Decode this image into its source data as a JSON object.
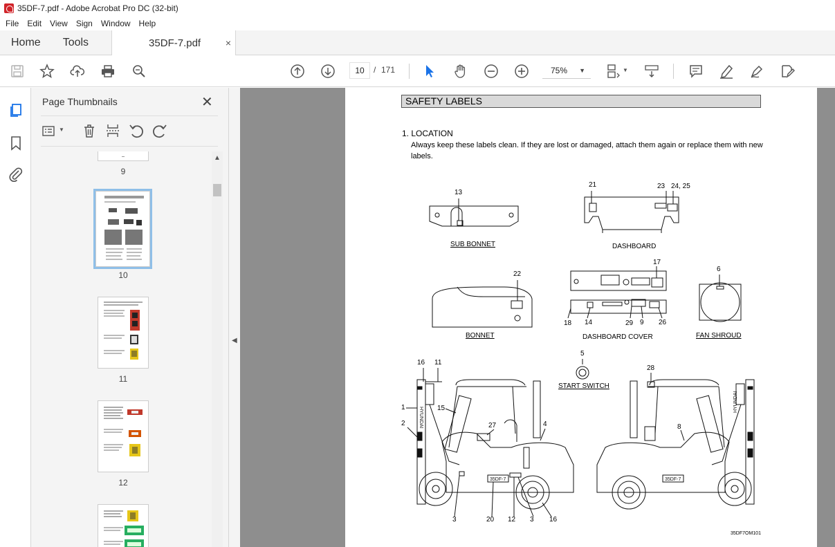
{
  "window": {
    "title": "35DF-7.pdf - Adobe Acrobat Pro DC (32-bit)"
  },
  "menu": [
    "File",
    "Edit",
    "View",
    "Sign",
    "Window",
    "Help"
  ],
  "tabs": {
    "home": "Home",
    "tools": "Tools",
    "document": "35DF-7.pdf",
    "close": "×"
  },
  "toolbar": {
    "page_current": "10",
    "page_sep": "/",
    "page_total": "171",
    "zoom": "75%"
  },
  "thumbnails": {
    "title": "Page Thumbnails",
    "close": "✕",
    "pages": [
      "9",
      "10",
      "11",
      "12"
    ],
    "selected": "10"
  },
  "page": {
    "heading": "SAFETY LABELS",
    "section": "1. LOCATION",
    "body": "Always keep these labels clean.  If they are lost or damaged, attach them again or replace them with new labels.",
    "labels": {
      "sub_bonnet": "SUB BONNET",
      "dashboard": "DASHBOARD",
      "bonnet": "BONNET",
      "dashboard_cover": "DASHBOARD COVER",
      "fan_shroud": "FAN SHROUD",
      "start_switch": "START SWITCH"
    },
    "numbers": {
      "n13": "13",
      "n21": "21",
      "n23": "23",
      "n2425": "24, 25",
      "n22": "22",
      "n17": "17",
      "n6": "6",
      "n18": "18",
      "n14": "14",
      "n29": "29",
      "n9": "9",
      "n26": "26",
      "n5": "5",
      "n16a": "16",
      "n11": "11",
      "n28": "28",
      "n1": "1",
      "n2": "2",
      "n15": "15",
      "n27": "27",
      "n4": "4",
      "n8": "8",
      "n3a": "3",
      "n20": "20",
      "n12": "12",
      "n3b": "3",
      "n16b": "16"
    },
    "brand_mast": "HYUNDAI",
    "model_plate": "35DF-7",
    "drawing_code": "35DF7OM101"
  },
  "colors": {
    "accent": "#1a73e8",
    "pdf_red": "#d1242a",
    "panel_bg": "#f4f4f4",
    "doc_bg": "#8e8e8e"
  }
}
